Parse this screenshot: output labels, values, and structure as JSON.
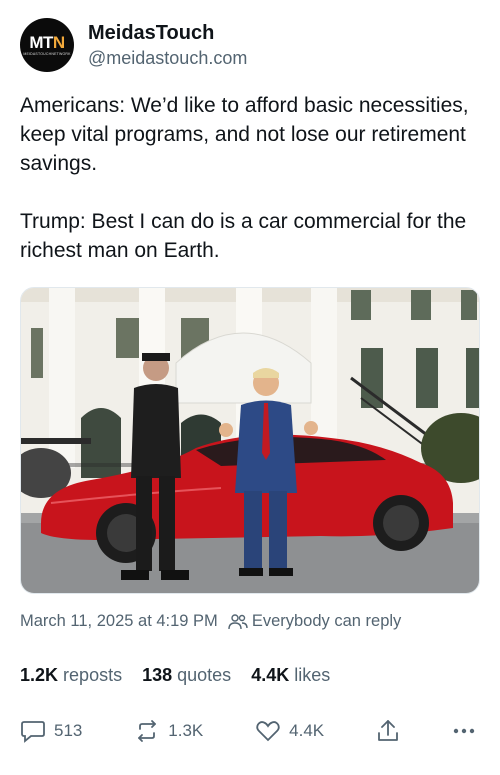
{
  "account": {
    "avatar_text_main": "MT",
    "avatar_text_accent": "N",
    "avatar_subtext": "MEIDASTOUCHNETWORK",
    "display_name": "MeidasTouch",
    "handle": "@meidastouch.com"
  },
  "post": {
    "text": "Americans: We’d like to afford basic necessities, keep vital programs, and not lose our retirement savings.\n\nTrump: Best I can do is a car commercial for the richest man on Earth.",
    "image_description_icon": "photo",
    "date": "March 11, 2025 at 4:19 PM",
    "reply_setting": "Everybody can reply"
  },
  "stats": {
    "reposts_count": "1.2K",
    "reposts_label": "reposts",
    "quotes_count": "138",
    "quotes_label": "quotes",
    "likes_count": "4.4K",
    "likes_label": "likes"
  },
  "actions": {
    "reply_count": "513",
    "repost_count": "1.3K",
    "like_count": "4.4K"
  },
  "icons": {
    "reply": "reply-icon",
    "repost": "repost-icon",
    "like": "heart-icon",
    "share": "share-icon",
    "more": "more-icon",
    "audience": "people-icon"
  },
  "colors": {
    "text": "#0f1419",
    "secondary": "#536471",
    "car_red": "#c8141c"
  }
}
